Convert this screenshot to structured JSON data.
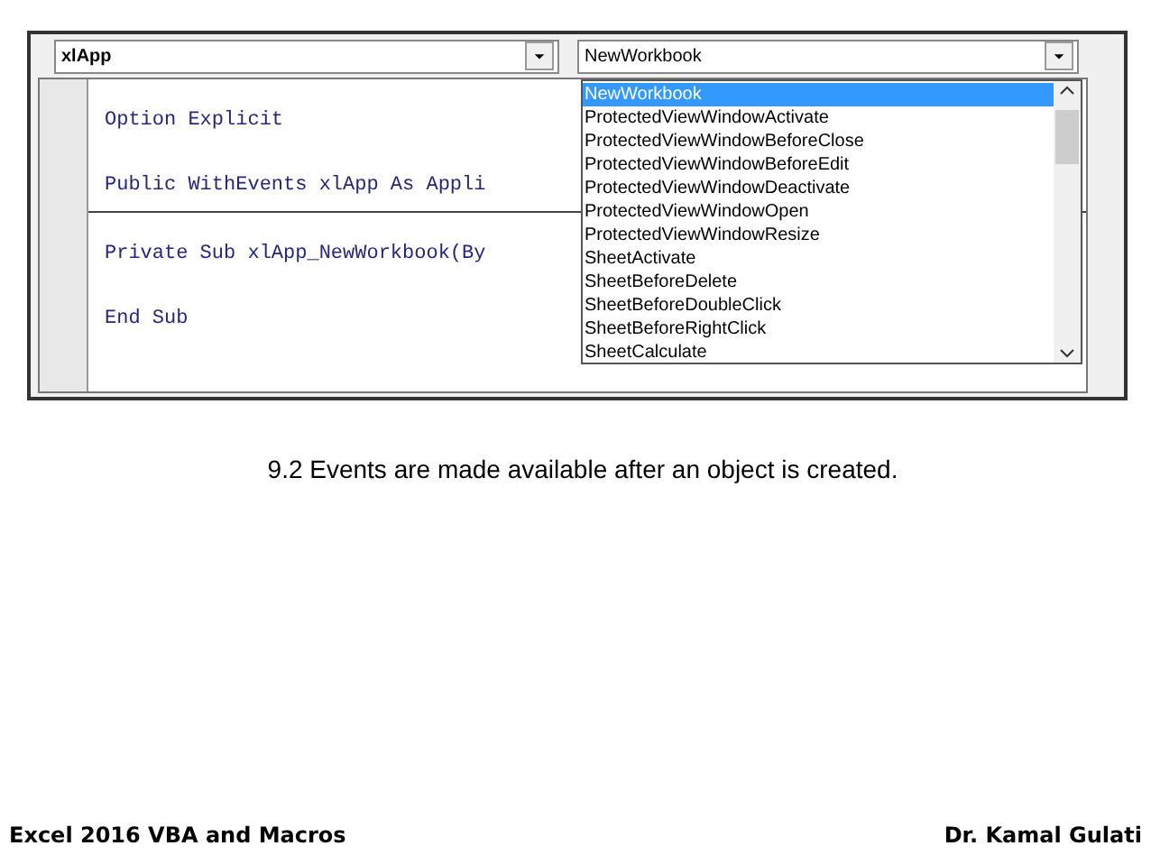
{
  "object_box": {
    "value": "xlApp"
  },
  "procedure_box": {
    "value": "NewWorkbook",
    "expanded": true
  },
  "code_lines": [
    {
      "text": "Option Explicit",
      "separator_after": false
    },
    {
      "text": "Public WithEvents xlApp As Appli",
      "separator_after": true
    },
    {
      "text": "Private Sub xlApp_NewWorkbook(By",
      "separator_after": false
    },
    {
      "text": "End Sub",
      "separator_after": false
    }
  ],
  "procedure_list": [
    {
      "label": "NewWorkbook",
      "selected": true
    },
    {
      "label": "ProtectedViewWindowActivate",
      "selected": false
    },
    {
      "label": "ProtectedViewWindowBeforeClose",
      "selected": false
    },
    {
      "label": "ProtectedViewWindowBeforeEdit",
      "selected": false
    },
    {
      "label": "ProtectedViewWindowDeactivate",
      "selected": false
    },
    {
      "label": "ProtectedViewWindowOpen",
      "selected": false
    },
    {
      "label": "ProtectedViewWindowResize",
      "selected": false
    },
    {
      "label": "SheetActivate",
      "selected": false
    },
    {
      "label": "SheetBeforeDelete",
      "selected": false
    },
    {
      "label": "SheetBeforeDoubleClick",
      "selected": false
    },
    {
      "label": "SheetBeforeRightClick",
      "selected": false
    },
    {
      "label": "SheetCalculate",
      "selected": false
    }
  ],
  "caption": "9.2 Events are made available after an object is created.",
  "footer": {
    "left": "Excel 2016 VBA and Macros",
    "right": "Dr. Kamal Gulati"
  }
}
